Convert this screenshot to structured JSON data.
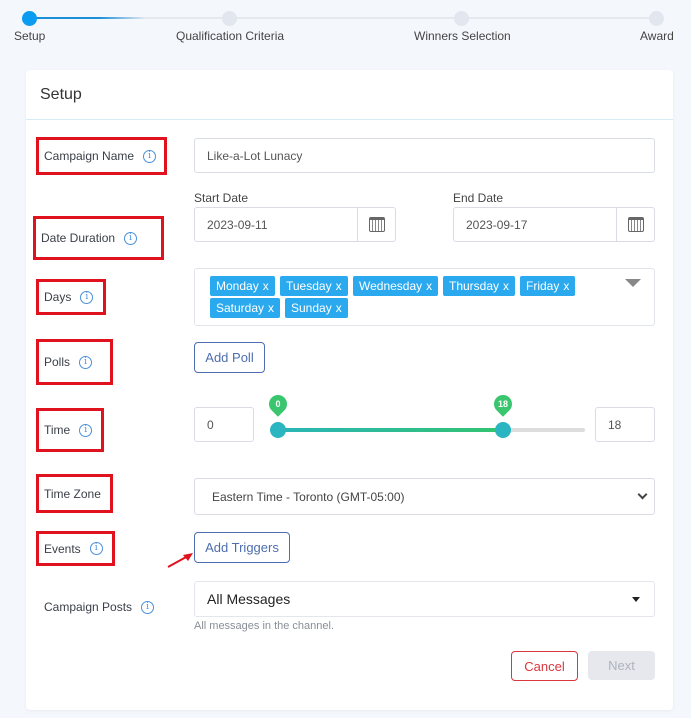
{
  "stepper": {
    "steps": [
      {
        "label": "Setup",
        "active": true
      },
      {
        "label": "Qualification Criteria",
        "active": false
      },
      {
        "label": "Winners Selection",
        "active": false
      },
      {
        "label": "Award",
        "active": false
      }
    ]
  },
  "card": {
    "title": "Setup",
    "fields": {
      "campaign_name": {
        "label": "Campaign Name",
        "value": "Like-a-Lot Lunacy"
      },
      "date_duration": {
        "label": "Date Duration",
        "start_label": "Start Date",
        "start_value": "2023-09-11",
        "end_label": "End Date",
        "end_value": "2023-09-17"
      },
      "days": {
        "label": "Days",
        "selected": [
          "Monday",
          "Tuesday",
          "Wednesday",
          "Thursday",
          "Friday",
          "Saturday",
          "Sunday"
        ],
        "remove_glyph": "x"
      },
      "polls": {
        "label": "Polls",
        "button": "Add Poll"
      },
      "time": {
        "label": "Time",
        "min_value": "0",
        "max_value": "18",
        "range_min": 0,
        "range_max": 24,
        "low": 0,
        "high": 18
      },
      "time_zone": {
        "label": "Time Zone",
        "value": "Eastern Time - Toronto (GMT-05:00)"
      },
      "events": {
        "label": "Events",
        "button": "Add Triggers"
      },
      "campaign_posts": {
        "label": "Campaign Posts",
        "value": "All Messages",
        "helper": "All messages in the channel."
      }
    },
    "info_glyph": "i",
    "actions": {
      "cancel": "Cancel",
      "next": "Next"
    }
  },
  "colors": {
    "accent": "#0a9cf0",
    "tag": "#2aa9ef",
    "highlight_box": "#e0121e",
    "cancel": "#d9363e",
    "slider_pin": "#3ac66e"
  }
}
